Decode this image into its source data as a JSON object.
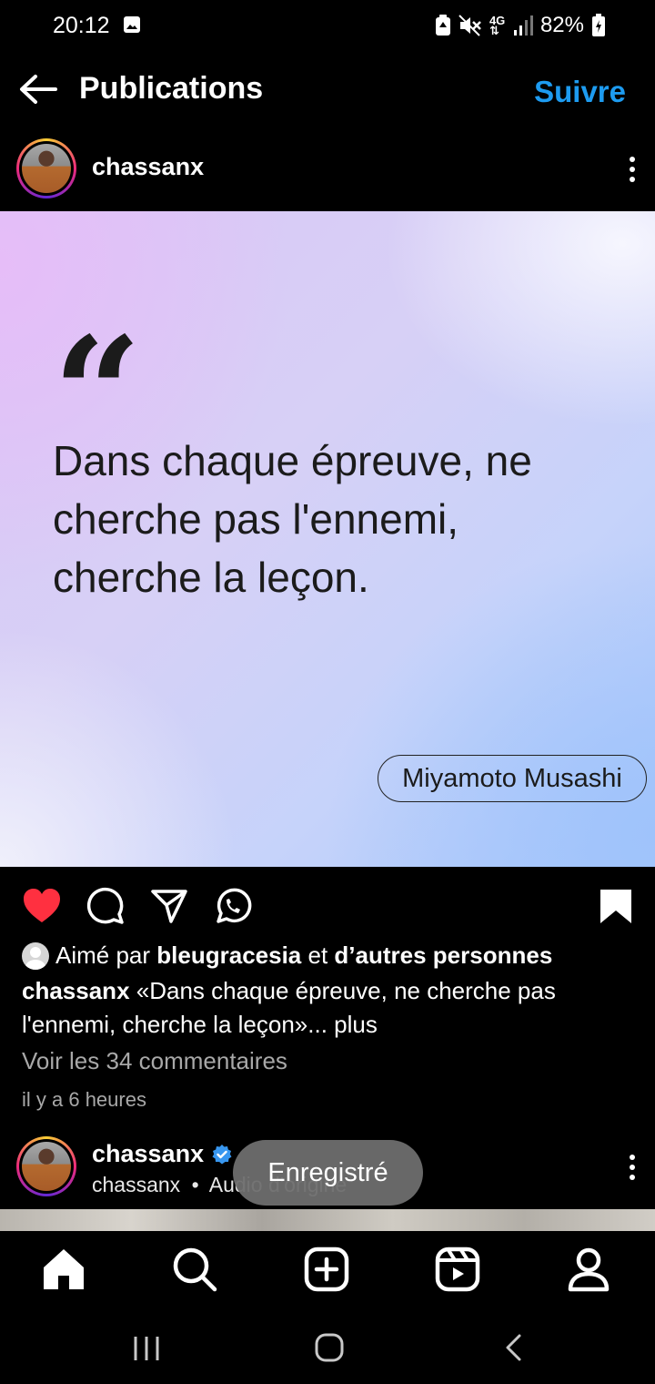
{
  "status_bar": {
    "time": "20:12",
    "battery": "82%",
    "network": "4G",
    "icons": [
      "image-icon",
      "battery-saver-icon",
      "mute-icon",
      "data-4g-icon",
      "signal-icon",
      "battery-charging-icon"
    ]
  },
  "header": {
    "title": "Publications",
    "follow_label": "Suivre"
  },
  "post": {
    "author": "chassanx",
    "image": {
      "quote_mark": "“",
      "quote_text": "Dans chaque épreuve, ne cherche pas l'ennemi, cherche la leçon.",
      "quote_author": "Miyamoto Musashi"
    },
    "likes": {
      "prefix": "Aimé par ",
      "user": "bleugracesia",
      "conjunction": " et ",
      "others": "d’autres personnes"
    },
    "caption": {
      "author": "chassanx",
      "text": " «Dans chaque épreuve, ne cherche pas l'ennemi, cherche la leçon»...",
      "more": " plus"
    },
    "comments_link": "Voir les 34 commentaires",
    "time_ago": "il y a 6 heures",
    "liked": true,
    "saved": true
  },
  "next_post": {
    "author": "chassanx",
    "verified": true,
    "sub_author": "chassanx",
    "separator": "•",
    "audio": "Audio d'origine"
  },
  "toast": {
    "text": "Enregistré"
  },
  "colors": {
    "accent": "#1d9bf0",
    "like": "#ff3040",
    "verified": "#3897f0"
  },
  "bottom_nav": [
    "home-icon",
    "search-icon",
    "create-icon",
    "reels-icon",
    "profile-icon"
  ],
  "system_nav": [
    "recent-apps-icon",
    "home-circle-icon",
    "back-chevron-icon"
  ]
}
